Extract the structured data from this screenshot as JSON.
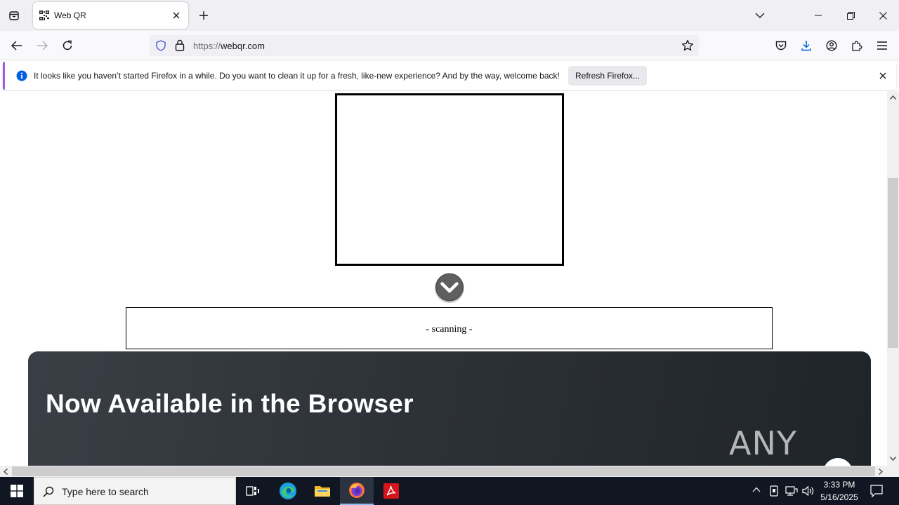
{
  "browser": {
    "tab_title": "Web QR",
    "url_prefix": "https://",
    "url_host": "webqr.com"
  },
  "notification": {
    "message": "It looks like you haven’t started Firefox in a while. Do you want to clean it up for a fresh, like-new experience? And by the way, welcome back!",
    "button_label": "Refresh Firefox..."
  },
  "page": {
    "scan_status": "- scanning -",
    "banner_title": "Now Available in the Browser",
    "watermark": "ANY RUN"
  },
  "taskbar": {
    "search_placeholder": "Type here to search",
    "time": "3:33 PM",
    "date": "5/16/2025"
  },
  "colors": {
    "accent_purple": "#a15dd6",
    "info_blue": "#0060df",
    "taskbar_bg": "#101722"
  }
}
